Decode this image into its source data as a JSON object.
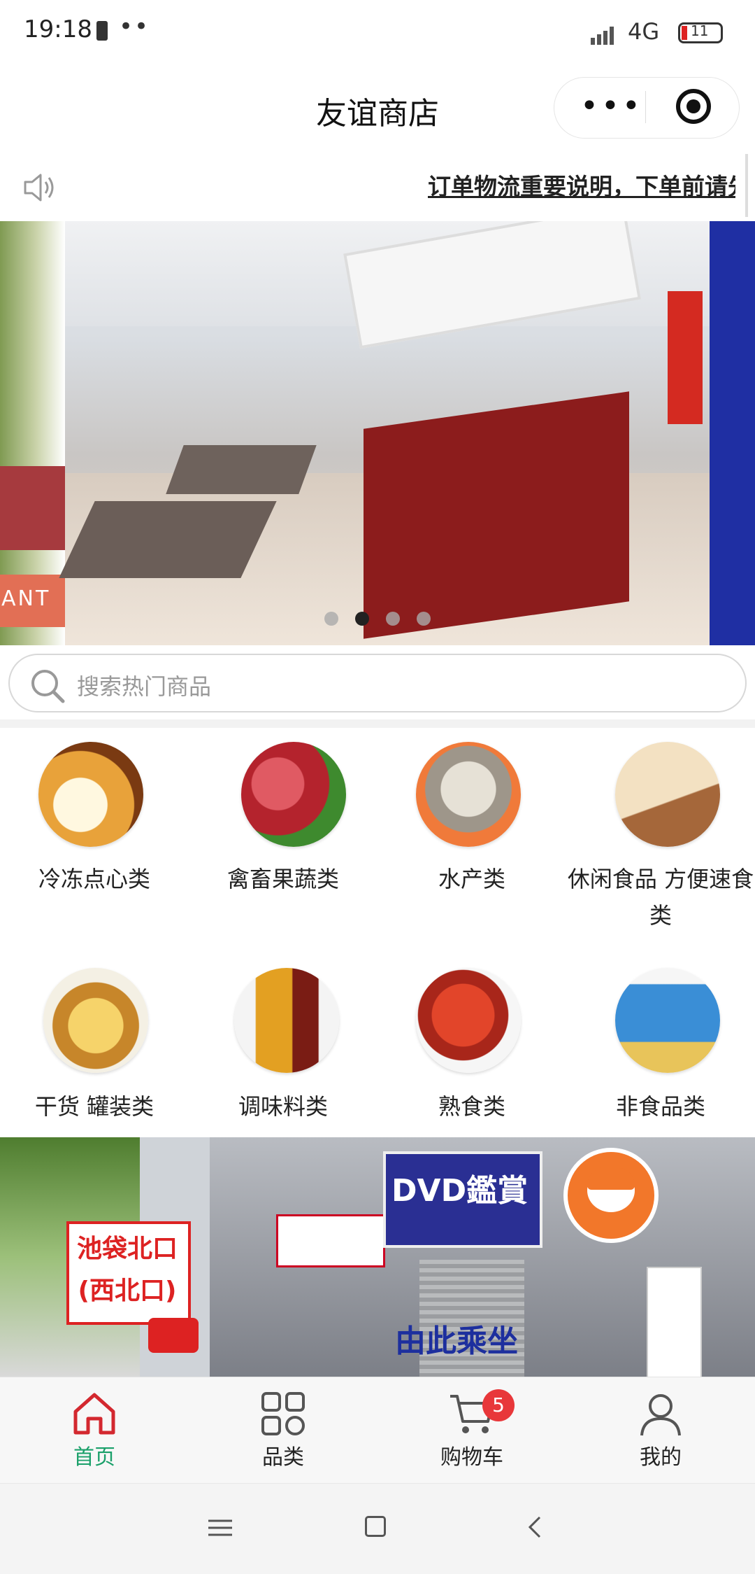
{
  "status_bar": {
    "time": "19:18",
    "dots": "••",
    "network": "4G",
    "battery": "11"
  },
  "header": {
    "title": "友谊商店",
    "more_label": "•••"
  },
  "notice": {
    "text": "订单物流重要说明，下单前请先"
  },
  "banner": {
    "prev_slide_text": "ANT",
    "slide_count": 4,
    "active_index": 1
  },
  "search": {
    "placeholder": "搜索热门商品"
  },
  "categories": [
    {
      "label": "冷冻点心类",
      "icon": "dumplings-image",
      "color": "#e8a23a"
    },
    {
      "label": "禽畜果蔬类",
      "icon": "meat-vegetable-image",
      "color": "#b4232d"
    },
    {
      "label": "水产类",
      "icon": "seafood-image",
      "color": "#d6d0c4"
    },
    {
      "label": "休闲食品 方便速食类",
      "icon": "snacks-image",
      "color": "#d6ad70"
    },
    {
      "label": "干货 罐装类",
      "icon": "dried-goods-image",
      "color": "#f1c35c"
    },
    {
      "label": "调味料类",
      "icon": "seasoning-image",
      "color": "#e3a022"
    },
    {
      "label": "熟食类",
      "icon": "cooked-food-image",
      "color": "#d4351f"
    },
    {
      "label": "非食品类",
      "icon": "non-food-image",
      "color": "#3a8ed6"
    }
  ],
  "banner2": {
    "left_sign": "池袋北口 (西北口)",
    "dvd_sign": "DVD鑑賞",
    "bottom_text": "由此乘坐"
  },
  "tabbar": {
    "items": [
      {
        "label": "首页",
        "active": true
      },
      {
        "label": "品类",
        "active": false
      },
      {
        "label": "购物车",
        "active": false
      },
      {
        "label": "我的",
        "active": false
      }
    ],
    "cart_badge": "5",
    "active_color": "#1aa06a",
    "home_icon_color": "#d3282f"
  }
}
